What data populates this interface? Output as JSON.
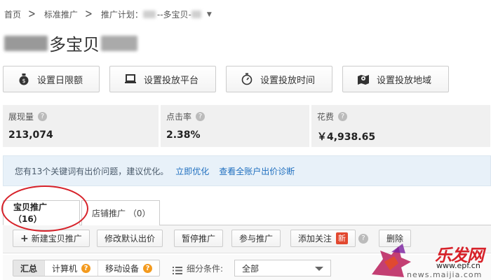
{
  "breadcrumb": {
    "home": "首页",
    "standard": "标准推广",
    "plan_label": "推广计划：",
    "plan_name": "--多宝贝-"
  },
  "page": {
    "title": "多宝贝"
  },
  "settings": [
    {
      "label": "设置日限额",
      "icon": "money-bag-icon"
    },
    {
      "label": "设置投放平台",
      "icon": "computer-icon"
    },
    {
      "label": "设置投放时间",
      "icon": "stopwatch-icon"
    },
    {
      "label": "设置投放地域",
      "icon": "map-pin-icon"
    }
  ],
  "metrics": [
    {
      "label": "展现量",
      "value": "213,074"
    },
    {
      "label": "点击率",
      "value": "2.38%"
    },
    {
      "label": "花费",
      "value": "￥4,938.65"
    }
  ],
  "alert": {
    "text": "您有13个关键词有出价问题，建议优化。",
    "link_optimize": "立即优化",
    "link_diagnose": "查看全账户出价诊断"
  },
  "tabs": [
    {
      "label": "宝贝推广 （16）",
      "active": true
    },
    {
      "label": "店铺推广 （0）",
      "active": false
    }
  ],
  "toolbar": {
    "new_item": "新建宝贝推广",
    "modify_bid": "修改默认出价",
    "pause": "暂停推广",
    "join": "参与推广",
    "follow": "添加关注",
    "new_badge": "新",
    "delete": "删除"
  },
  "filter": {
    "seg_all": "汇总",
    "seg_computer": "计算机",
    "seg_mobile": "移动设备",
    "label": "细分条件:",
    "select_value": "全部"
  },
  "watermark": {
    "brand": "乐发网",
    "url": "www.epf.cn",
    "url2": "news.maijia.com"
  },
  "colors": {
    "accent_red": "#d7222a",
    "link_blue": "#1f6fbf",
    "warn_orange": "#f39a1e",
    "alert_bg": "#e8f1f9",
    "metric_bg": "#f0f0f0"
  }
}
